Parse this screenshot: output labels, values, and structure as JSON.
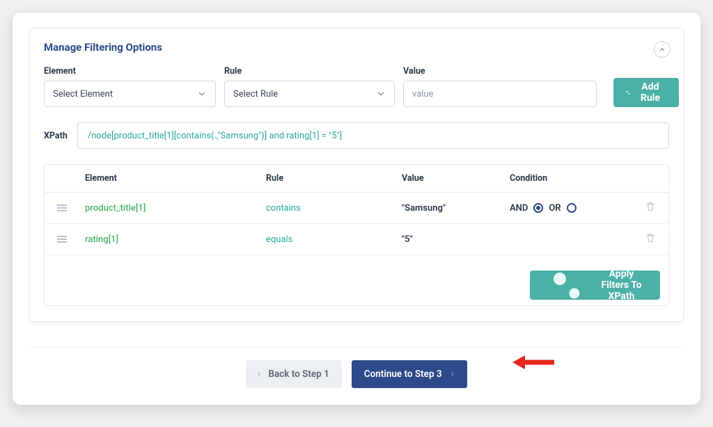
{
  "section_title": "Manage Filtering Options",
  "fields": {
    "element_label": "Element",
    "element_placeholder": "Select Element",
    "rule_label": "Rule",
    "rule_placeholder": "Select Rule",
    "value_label": "Value",
    "value_placeholder": "value"
  },
  "buttons": {
    "add_rule": "Add Rule",
    "apply_filters": "Apply Filters To XPath",
    "back": "Back to Step 1",
    "continue": "Continue to Step 3"
  },
  "xpath": {
    "label": "XPath",
    "expression": "/node[product_title[1][contains(.,\"Samsung\")] and rating[1] = \"5\"]"
  },
  "table": {
    "headers": {
      "element": "Element",
      "rule": "Rule",
      "value": "Value",
      "condition": "Condition"
    },
    "rows": [
      {
        "element": "product_title[1]",
        "rule": "contains",
        "value": "\"Samsung\"",
        "condition": {
          "and": "AND",
          "or": "OR",
          "selected": "AND"
        }
      },
      {
        "element": "rating[1]",
        "rule": "equals",
        "value": "\"5\"",
        "condition": null
      }
    ]
  }
}
